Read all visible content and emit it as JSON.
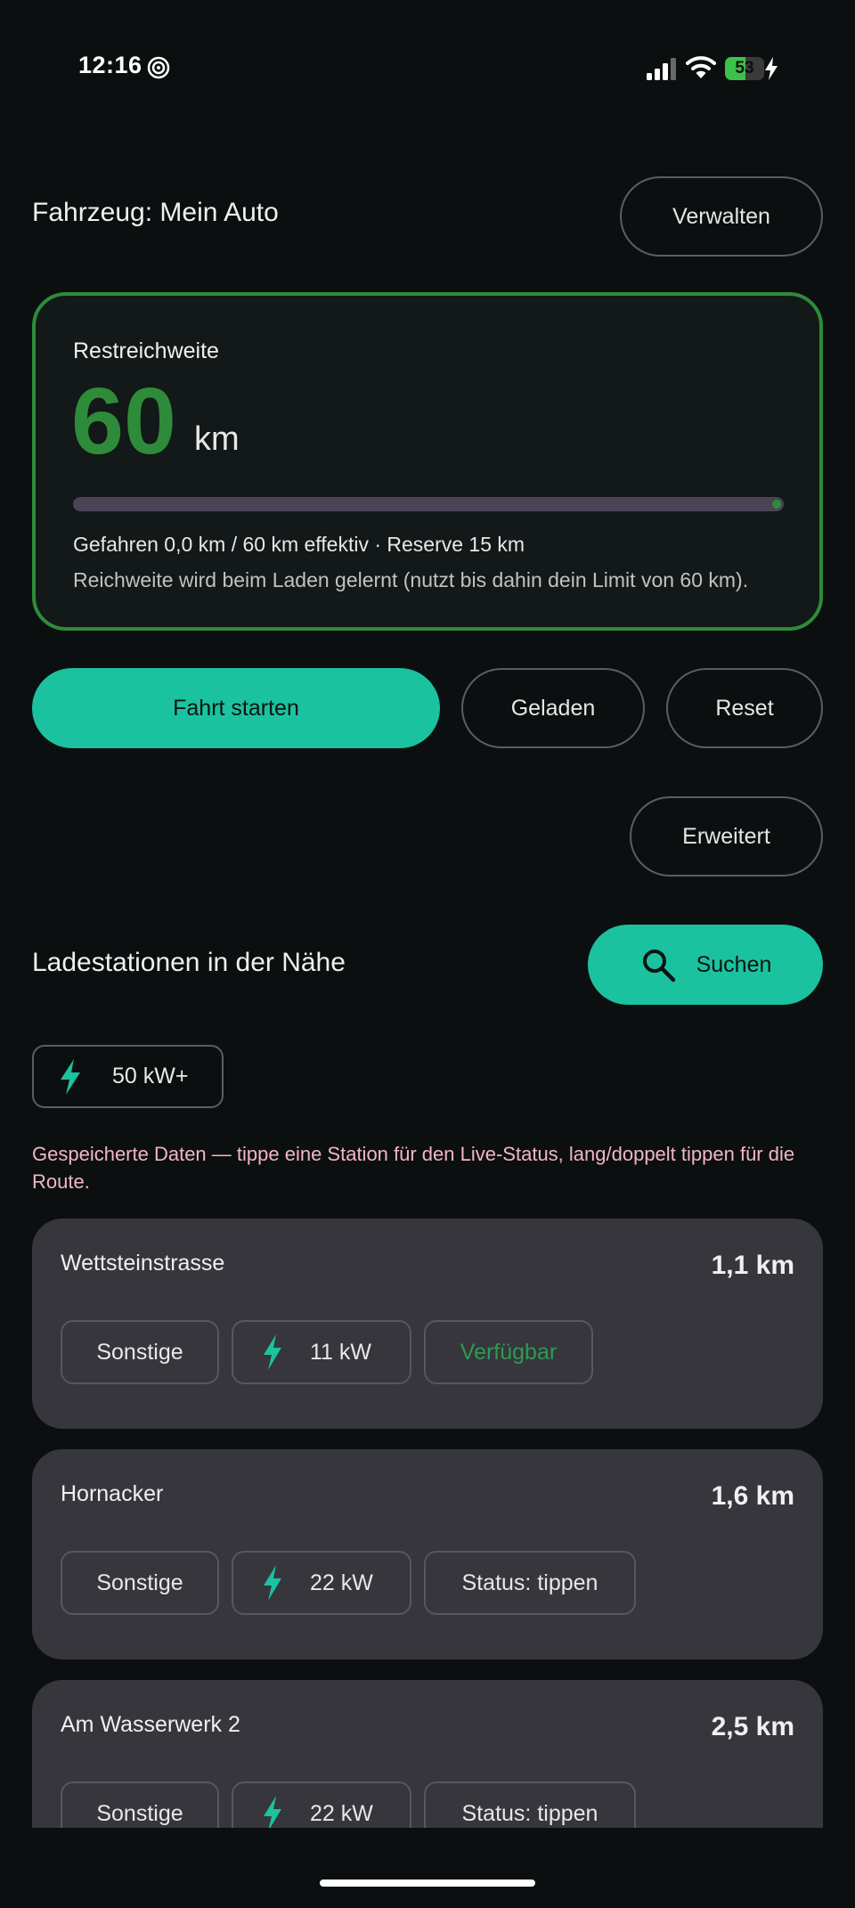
{
  "status_bar": {
    "time": "12:16",
    "battery_percent": "53",
    "battery_level": 0.53,
    "icons": [
      "focus-icon",
      "signal-icon",
      "wifi-icon",
      "battery-icon",
      "charging-bolt-icon"
    ]
  },
  "header": {
    "vehicle_title": "Fahrzeug: Mein Auto",
    "manage_label": "Verwalten"
  },
  "range_card": {
    "label": "Restreichweite",
    "value": "60",
    "unit": "km",
    "progress": 1.0,
    "info": "Gefahren 0,0 km / 60 km effektiv · Reserve 15 km",
    "hint": "Reichweite wird beim Laden gelernt (nutzt bis dahin dein Limit von 60 km).",
    "accent_color": "#2e8b3a"
  },
  "actions": {
    "start_label": "Fahrt starten",
    "charged_label": "Geladen",
    "reset_label": "Reset",
    "advanced_label": "Erweitert"
  },
  "stations": {
    "title": "Ladestationen in der Nähe",
    "search_label": "Suchen",
    "filter_label": "50 kW+",
    "note": "Gespeicherte Daten — tippe eine Station für den Live-Status, lang/doppelt tippen für die Route.",
    "items": [
      {
        "name": "Wettsteinstrasse",
        "distance": "1,1 km",
        "type": "Sonstige",
        "power": "11 kW",
        "status": "Verfügbar"
      },
      {
        "name": "Hornacker",
        "distance": "1,6 km",
        "type": "Sonstige",
        "power": "22 kW",
        "status": "Status: tippen"
      },
      {
        "name": "Am Wasserwerk 2",
        "distance": "2,5 km",
        "type": "Sonstige",
        "power": "22 kW",
        "status": "Status: tippen"
      }
    ]
  },
  "colors": {
    "background": "#0c0f0f",
    "primary": "#1bc29f",
    "range_green": "#2e8b3a",
    "note_pink": "#f2b6c6",
    "status_available": "#2e9a52"
  }
}
